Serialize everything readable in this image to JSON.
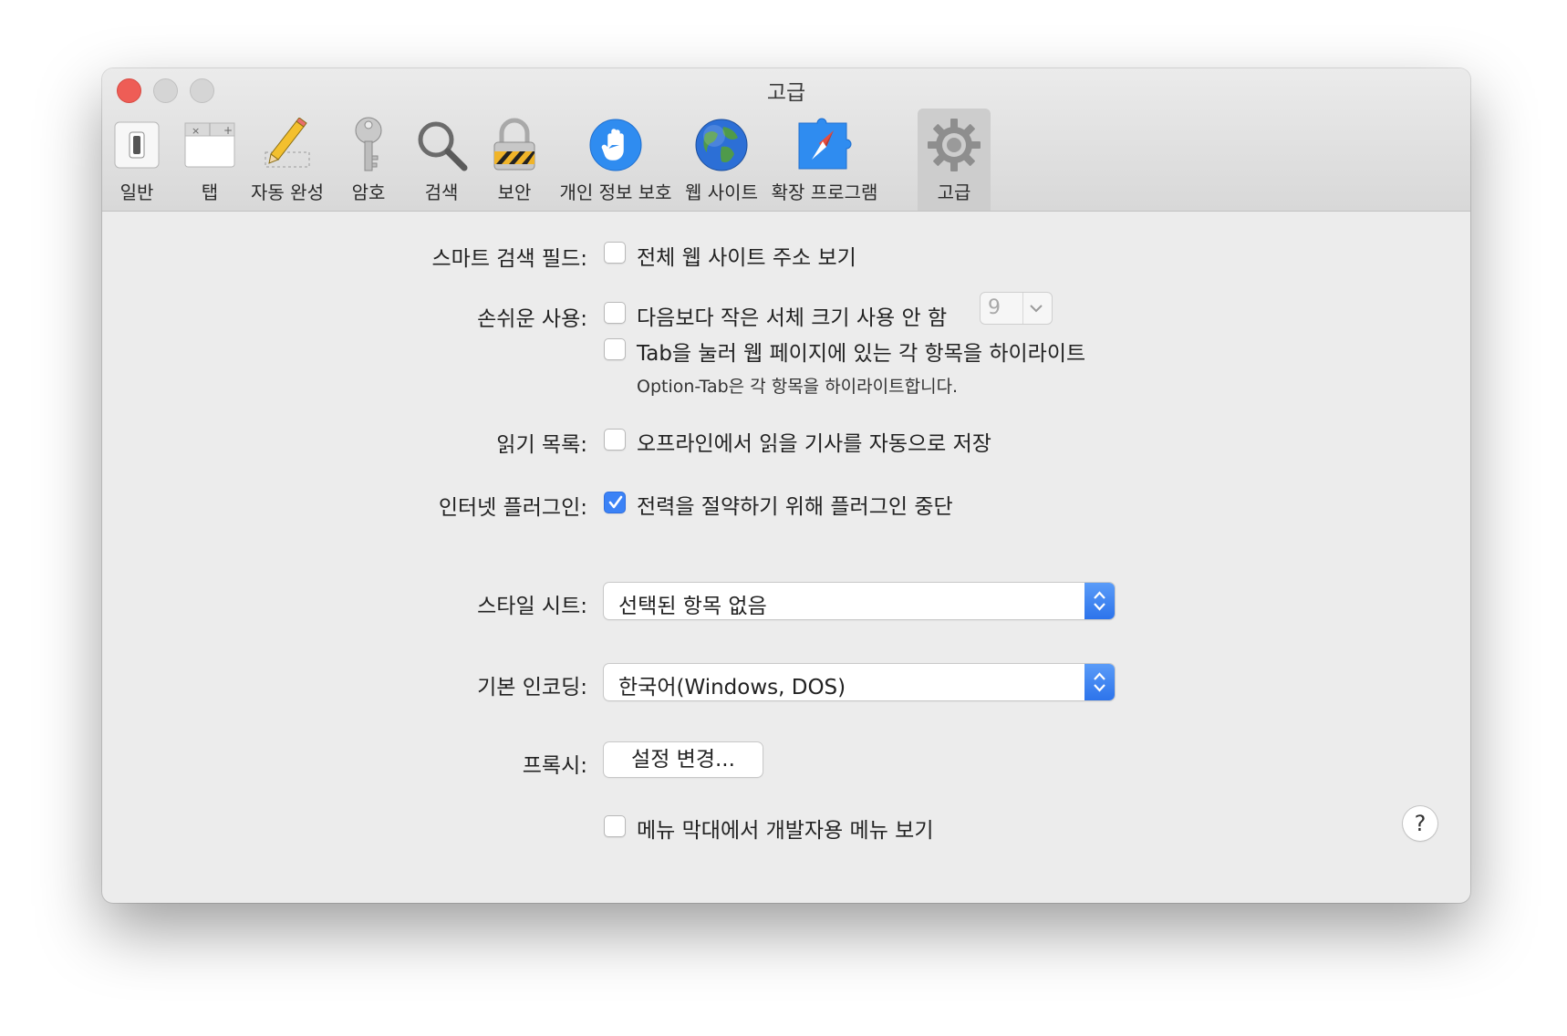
{
  "window": {
    "title": "고급"
  },
  "toolbar": {
    "items": [
      {
        "label": "일반",
        "icon": "switch-icon"
      },
      {
        "label": "탭",
        "icon": "tabs-icon"
      },
      {
        "label": "자동 완성",
        "icon": "pencil-icon"
      },
      {
        "label": "암호",
        "icon": "key-icon"
      },
      {
        "label": "검색",
        "icon": "magnifier-icon"
      },
      {
        "label": "보안",
        "icon": "lock-icon"
      },
      {
        "label": "개인 정보 보호",
        "icon": "hand-icon"
      },
      {
        "label": "웹 사이트",
        "icon": "globe-icon"
      },
      {
        "label": "확장 프로그램",
        "icon": "puzzle-compass-icon"
      },
      {
        "label": "고급",
        "icon": "gear-icon",
        "selected": true
      }
    ]
  },
  "settings": {
    "smart_search": {
      "label": "스마트 검색 필드:",
      "option": "전체 웹 사이트 주소 보기",
      "checked": false
    },
    "accessibility": {
      "label": "손쉬운 사용:",
      "min_font_option": "다음보다 작은 서체 크기 사용 안 함",
      "min_font_checked": false,
      "min_font_value": "9",
      "tab_option": "Tab을 눌러 웹 페이지에 있는 각 항목을 하이라이트",
      "tab_checked": false,
      "tab_note": "Option-Tab은 각 항목을 하이라이트합니다."
    },
    "reading_list": {
      "label": "읽기 목록:",
      "option": "오프라인에서 읽을 기사를 자동으로 저장",
      "checked": false
    },
    "plugins": {
      "label": "인터넷 플러그인:",
      "option": "전력을 절약하기 위해 플러그인 중단",
      "checked": true
    },
    "style_sheet": {
      "label": "스타일 시트:",
      "value": "선택된 항목 없음"
    },
    "encoding": {
      "label": "기본 인코딩:",
      "value": "한국어(Windows, DOS)"
    },
    "proxy": {
      "label": "프록시:",
      "button": "설정 변경..."
    },
    "develop_menu": {
      "option": "메뉴 막대에서 개발자용 메뉴 보기",
      "checked": false
    },
    "help": "?"
  },
  "colors": {
    "accent": "#3b82f6",
    "close": "#ee5d56"
  }
}
